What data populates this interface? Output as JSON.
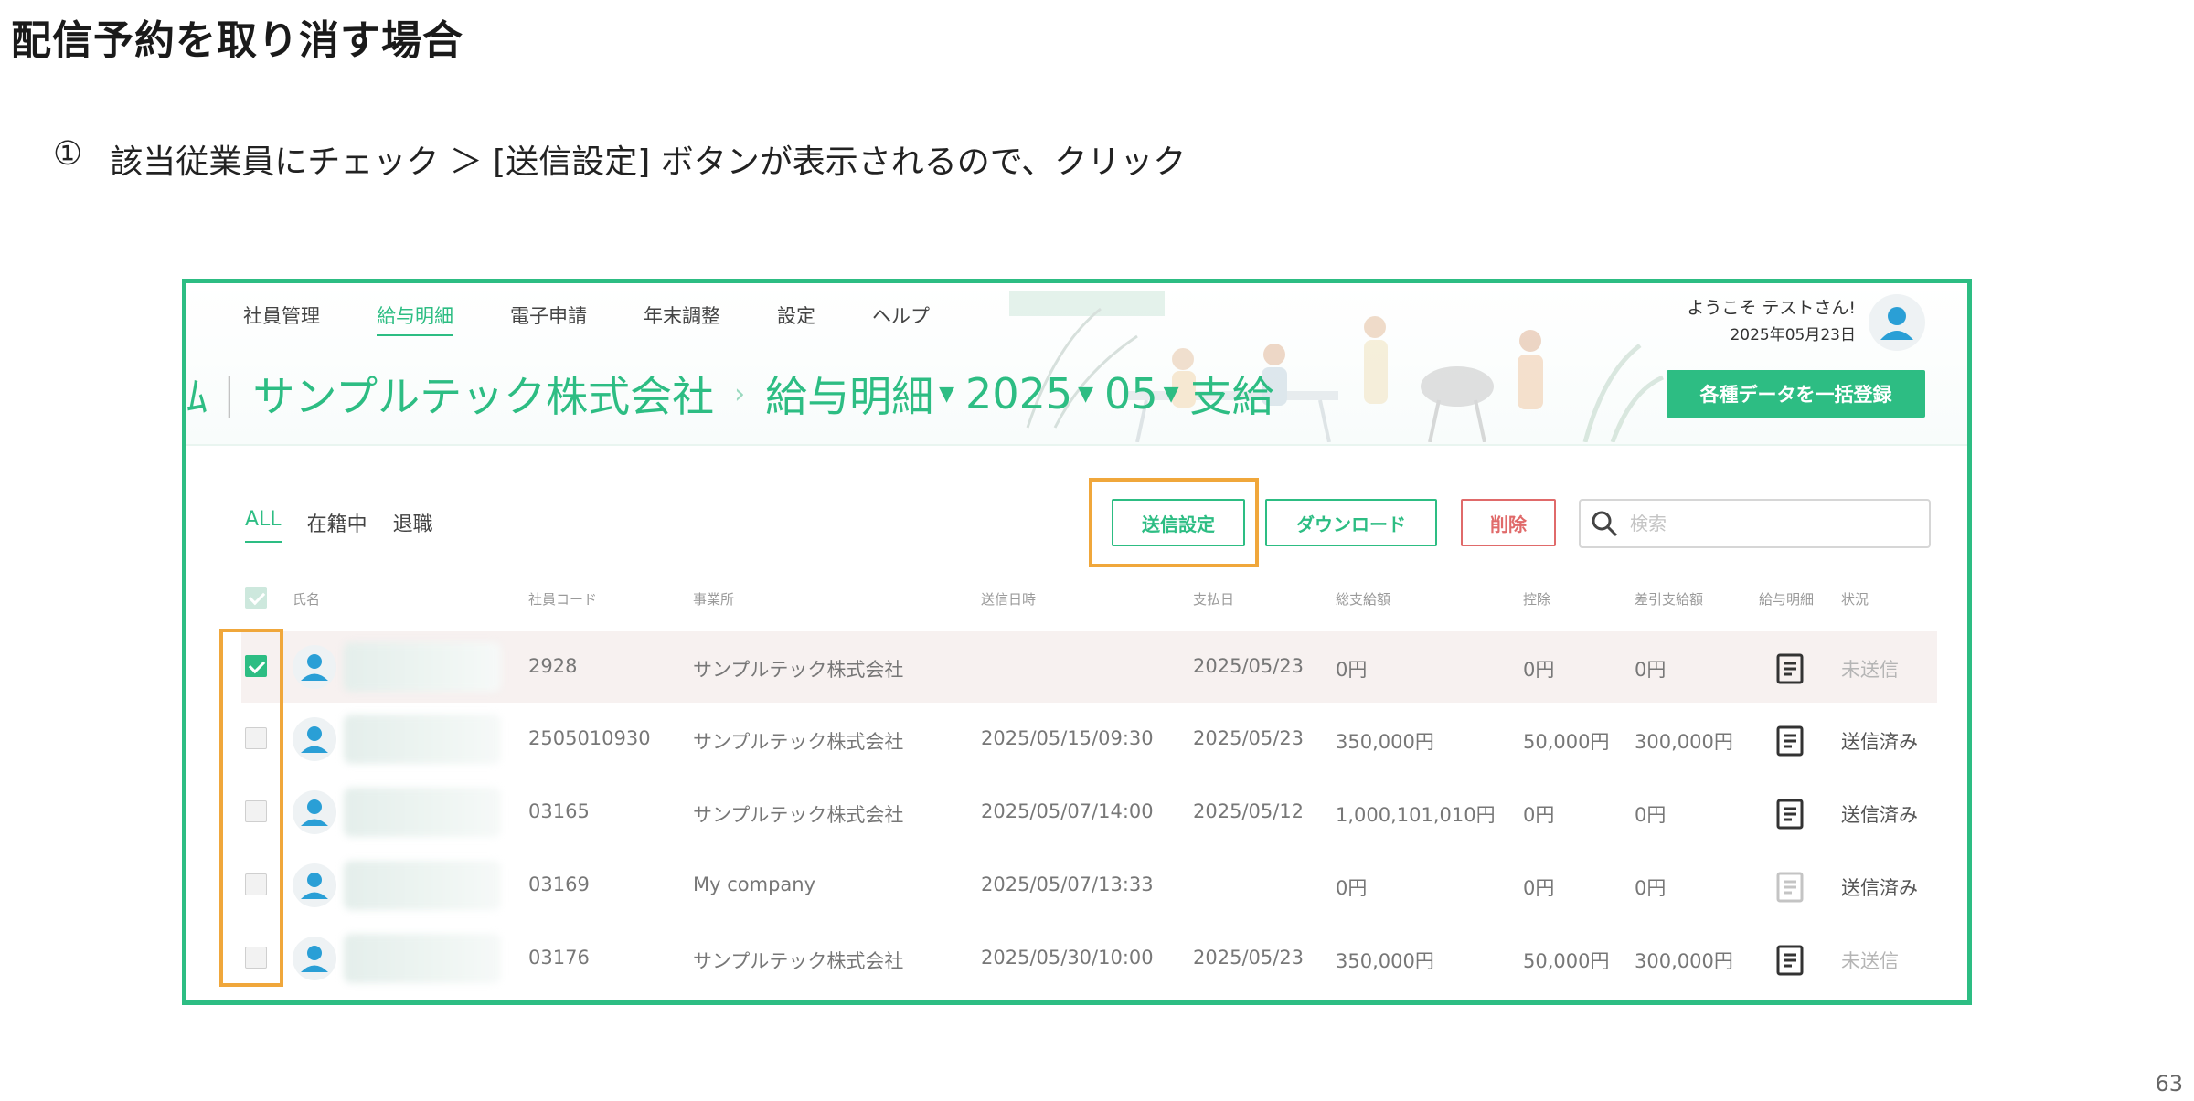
{
  "slide": {
    "title": "配信予約を取り消す場合",
    "step_number": "①",
    "step_text": "該当従業員にチェック ＞ [送信設定] ボタンが表示されるので、クリック",
    "page_number": "63"
  },
  "app": {
    "nav": [
      "社員管理",
      "給与明細",
      "電子申請",
      "年末調整",
      "設定",
      "ヘルプ"
    ],
    "active_nav": "給与明細",
    "breadcrumb": {
      "cut_text": "ﾑ",
      "company": "サンプルテック株式会社",
      "section": "給与明細",
      "year": "2025",
      "month": "05",
      "type": "支給"
    },
    "welcome": "ようこそ テストさん!",
    "date": "2025年05月23日",
    "bulk_register_label": "各種データを一括登録",
    "filters": [
      "ALL",
      "在籍中",
      "退職"
    ],
    "active_filter": "ALL",
    "buttons": {
      "send_settings": "送信設定",
      "download": "ダウンロード",
      "delete": "削除"
    },
    "search_placeholder": "検索",
    "table": {
      "headers": [
        "氏名",
        "社員コード",
        "事業所",
        "送信日時",
        "支払日",
        "総支給額",
        "控除",
        "差引支給額",
        "給与明細",
        "状況"
      ],
      "rows": [
        {
          "checked": true,
          "code": "2928",
          "office": "サンプルテック株式会社",
          "sent_at": "",
          "pay_date": "2025/05/23",
          "gross": "0円",
          "deduction": "0円",
          "net": "0円",
          "status": "未送信"
        },
        {
          "checked": false,
          "code": "2505010930",
          "office": "サンプルテック株式会社",
          "sent_at": "2025/05/15/09:30",
          "pay_date": "2025/05/23",
          "gross": "350,000円",
          "deduction": "50,000円",
          "net": "300,000円",
          "status": "送信済み"
        },
        {
          "checked": false,
          "code": "03165",
          "office": "サンプルテック株式会社",
          "sent_at": "2025/05/07/14:00",
          "pay_date": "2025/05/12",
          "gross": "1,000,101,010円",
          "deduction": "0円",
          "net": "0円",
          "status": "送信済み"
        },
        {
          "checked": false,
          "code": "03169",
          "office": "My company",
          "sent_at": "2025/05/07/13:33",
          "pay_date": "",
          "gross": "0円",
          "deduction": "0円",
          "net": "0円",
          "status": "送信済み"
        },
        {
          "checked": false,
          "code": "03176",
          "office": "サンプルテック株式会社",
          "sent_at": "2025/05/30/10:00",
          "pay_date": "2025/05/23",
          "gross": "350,000円",
          "deduction": "50,000円",
          "net": "300,000円",
          "status": "未送信"
        }
      ]
    }
  },
  "colors": {
    "brand": "#2dbd83",
    "highlight": "#f0a73b",
    "danger": "#e06a6a"
  }
}
